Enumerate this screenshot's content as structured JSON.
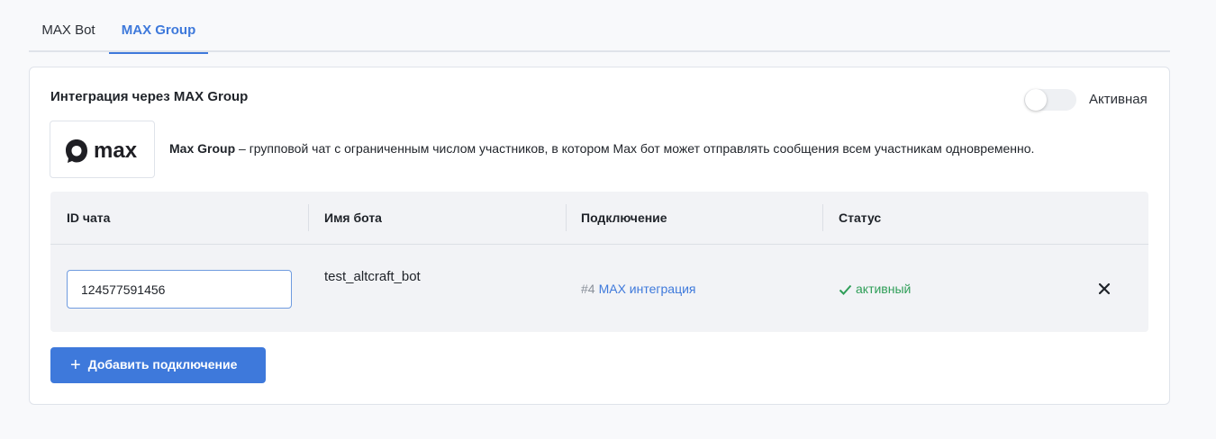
{
  "tabs": [
    {
      "label": "MAX Bot",
      "active": false
    },
    {
      "label": "MAX Group",
      "active": true
    }
  ],
  "card": {
    "title": "Интеграция через MAX Group",
    "toggle": {
      "label": "Активная",
      "on": false
    },
    "logo_text": "max",
    "description": {
      "bold": "Max Group",
      "text": " – групповой чат с ограниченным числом участников, в котором Max бот может отправлять сообщения всем участникам одновременно."
    }
  },
  "table": {
    "headers": [
      "ID чата",
      "Имя бота",
      "Подключение",
      "Статус"
    ],
    "rows": [
      {
        "chat_id": "124577591456",
        "bot_name": "test_altcraft_bot",
        "connection_num": "#4",
        "connection_name": "MAX интеграция",
        "status": "активный"
      }
    ]
  },
  "add_button": {
    "label": "Добавить подключение",
    "icon": "plus-icon"
  },
  "colors": {
    "accent": "#3e79db",
    "status_active": "#2f9e58",
    "background": "#f8f9fb"
  }
}
